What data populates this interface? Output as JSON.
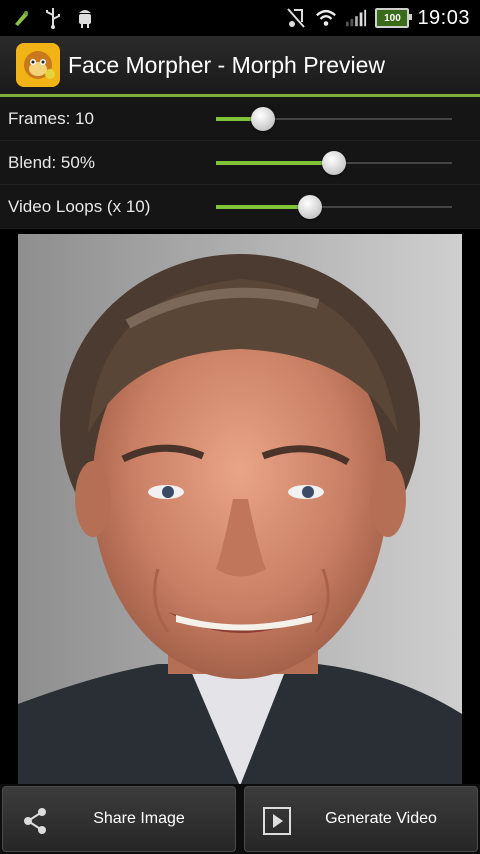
{
  "status_bar": {
    "time": "19:03",
    "battery_level": "100",
    "icons": [
      "android-debug-icon",
      "usb-icon",
      "android-robot-icon",
      "no-music-icon",
      "wifi-icon",
      "signal-icon",
      "battery-icon"
    ]
  },
  "title_bar": {
    "title": "Face Morpher - Morph Preview",
    "app_icon": "monkey-face-icon",
    "accent_color": "#7fb23b"
  },
  "settings": {
    "frames": {
      "label": "Frames: 10",
      "fraction": 0.2
    },
    "blend": {
      "label": "Blend: 50%",
      "fraction": 0.5
    },
    "video_loops": {
      "label": "Video Loops (x 10)",
      "fraction": 0.4
    }
  },
  "bottom_bar": {
    "share_label": "Share Image",
    "generate_label": "Generate Video",
    "share_icon": "share-icon",
    "video_icon": "play-icon"
  }
}
